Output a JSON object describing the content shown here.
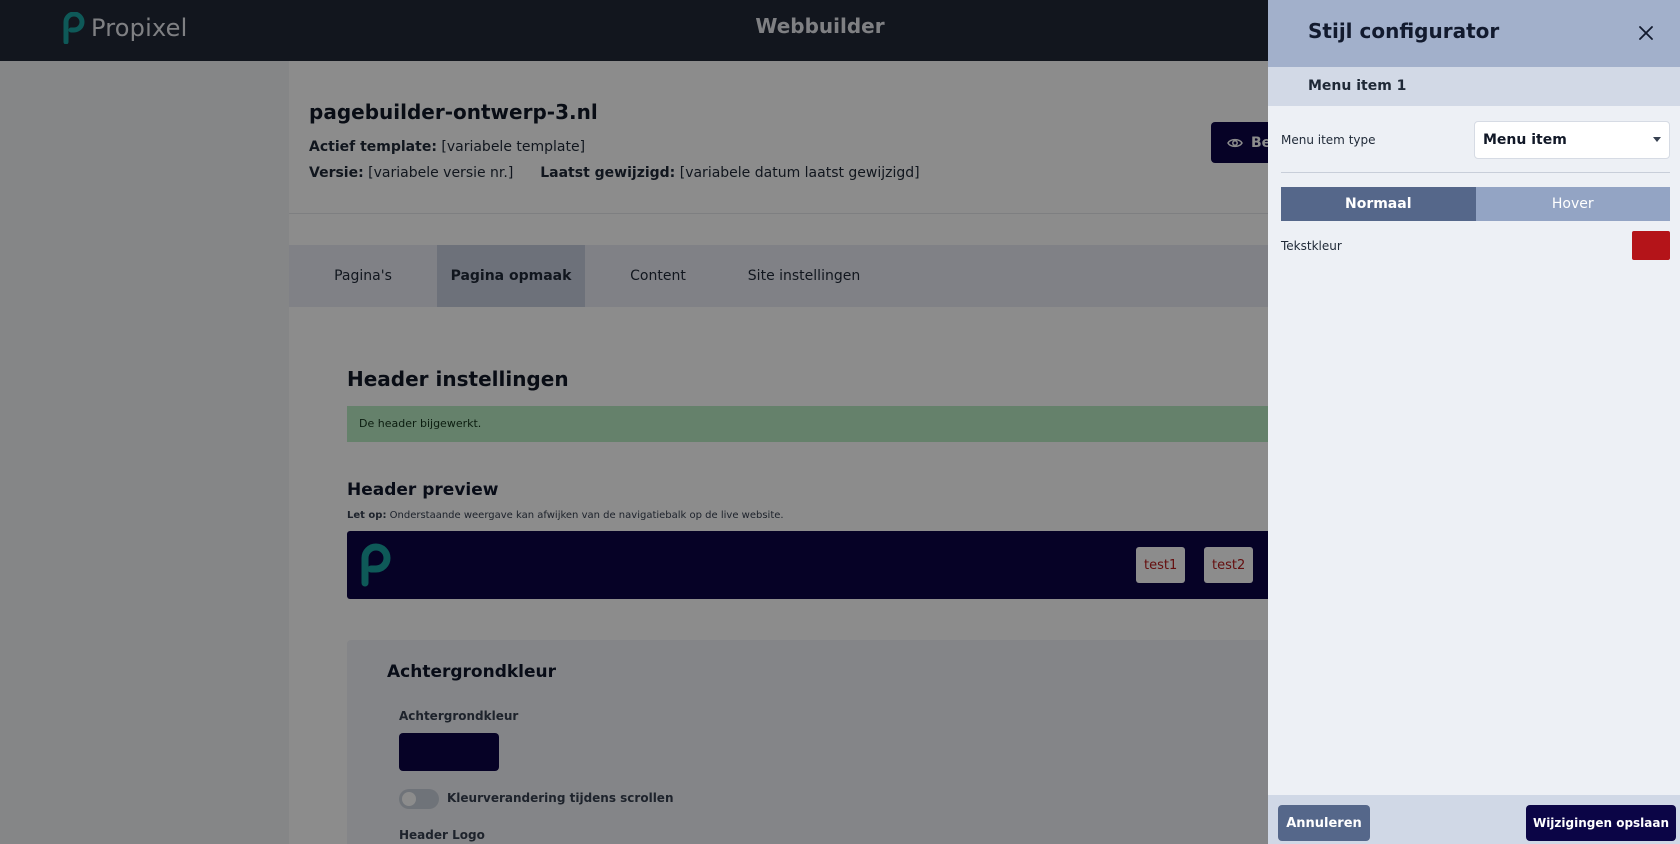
{
  "topbar": {
    "brand": "Propixel",
    "title": "Webbuilder"
  },
  "page": {
    "site_name": "pagebuilder-ontwerp-3.nl",
    "template_label": "Actief template:",
    "template_value": "[variabele template]",
    "version_label": "Versie:",
    "version_value": "[variabele versie nr.]",
    "modified_label": "Laatst gewijzigd:",
    "modified_value": "[variabele datum laatst gewijzigd]",
    "preview_button": "Be",
    "tabs": [
      {
        "label": "Pagina's",
        "active": false
      },
      {
        "label": "Pagina opmaak",
        "active": true
      },
      {
        "label": "Content",
        "active": false
      },
      {
        "label": "Site instellingen",
        "active": false
      }
    ],
    "header_settings_title": "Header instellingen",
    "alert": "De header bijgewerkt.",
    "preview_title": "Header preview",
    "preview_note_bold": "Let op:",
    "preview_note": " Onderstaande weergave kan afwijken van de navigatiebalk op de live website.",
    "nav_items": [
      "test1",
      "test2"
    ],
    "bg_section_title": "Achtergrondkleur",
    "bg_label": "Achtergrondkleur",
    "bg_color": "#0b0546",
    "scroll_toggle_label": "Kleurverandering tijdens scrollen",
    "logo_label": "Header Logo"
  },
  "panel": {
    "title": "Stijl configurator",
    "subtitle": "Menu item 1",
    "type_label": "Menu item type",
    "type_value": "Menu item",
    "seg_normal": "Normaal",
    "seg_hover": "Hover",
    "text_color_label": "Tekstkleur",
    "text_color": "#b41419",
    "cancel": "Annuleren",
    "save": "Wijzigingen opslaan"
  },
  "colors": {
    "brand_teal": "#1aa3a0",
    "navy": "#0b0546",
    "topbar": "#212837"
  }
}
